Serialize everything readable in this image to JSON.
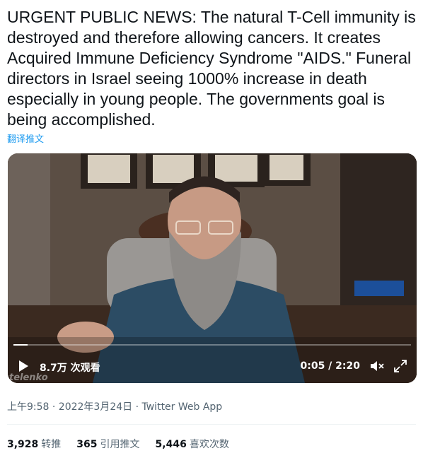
{
  "tweet": {
    "text": "URGENT PUBLIC NEWS: The natural T-Cell immunity is destroyed and therefore allowing cancers. It creates Acquired Immune Deficiency Syndrome \"AIDS.\" Funeral directors in Israel seeing 1000% increase in death especially in young people. The governments goal is being accomplished.",
    "translate_label": "翻译推文"
  },
  "video": {
    "views": "8.7万 次观看",
    "time": "0:05 / 2:20",
    "progress": 0.036,
    "watermark": "telenko"
  },
  "meta": {
    "timestamp": "上午9:58 · 2022年3月24日 · ",
    "source": "Twitter Web App"
  },
  "stats": {
    "retweets_count": "3,928",
    "retweets_label": "转推",
    "quotes_count": "365",
    "quotes_label": "引用推文",
    "likes_count": "5,446",
    "likes_label": "喜欢次数"
  },
  "colors": {
    "link": "#1d9bf0",
    "secondary_text": "#536471",
    "primary_text": "#0f1419"
  }
}
